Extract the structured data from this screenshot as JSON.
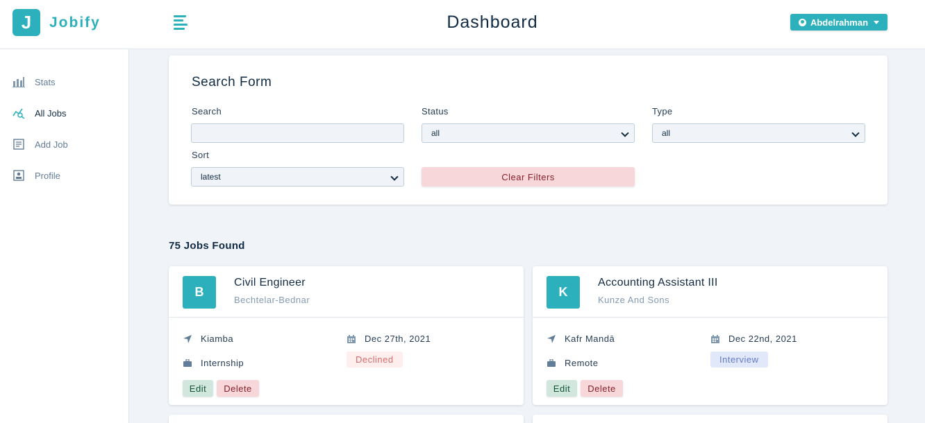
{
  "app": {
    "logo_letter": "J",
    "logo_text": "Jobify",
    "page_title": "Dashboard"
  },
  "user": {
    "name": "Abdelrahman"
  },
  "sidebar": {
    "items": [
      {
        "label": "Stats",
        "icon": "bar-chart-icon"
      },
      {
        "label": "All Jobs",
        "icon": "query-stats-icon",
        "active": true
      },
      {
        "label": "Add Job",
        "icon": "form-icon"
      },
      {
        "label": "Profile",
        "icon": "profile-icon"
      }
    ]
  },
  "search_form": {
    "title": "Search Form",
    "search_label": "Search",
    "search_value": "",
    "status_label": "Status",
    "status_value": "all",
    "type_label": "Type",
    "type_value": "all",
    "sort_label": "Sort",
    "sort_value": "latest",
    "clear_label": "Clear Filters"
  },
  "jobs_found": "75 Jobs Found",
  "jobs": [
    {
      "letter": "B",
      "position": "Civil Engineer",
      "company": "Bechtelar-Bednar",
      "location": "Kiamba",
      "date": "Dec 27th, 2021",
      "type": "Internship",
      "status": "Declined",
      "edit_label": "Edit",
      "delete_label": "Delete"
    },
    {
      "letter": "K",
      "position": "Accounting Assistant III",
      "company": "Kunze And Sons",
      "location": "Kafr Mandā",
      "date": "Dec 22nd, 2021",
      "type": "Remote",
      "status": "Interview",
      "edit_label": "Edit",
      "delete_label": "Delete"
    }
  ],
  "colors": {
    "primary": "#2cb1bc",
    "declined": "#d66a6a",
    "interview": "#647acb",
    "background": "#f0f4f8"
  }
}
